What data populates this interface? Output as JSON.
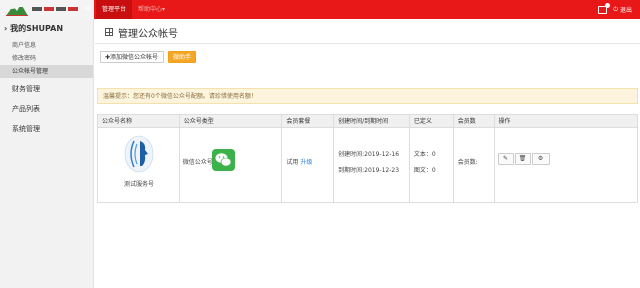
{
  "topbar": {
    "menu_icon": "hamburger-icon",
    "nav": [
      {
        "label": "管理平台",
        "active": true
      },
      {
        "label": "帮助中心▾",
        "active": false
      }
    ],
    "logout_label": "退出",
    "accent_color": "#e81818"
  },
  "sidebar": {
    "section_title": "我的SHUPAN",
    "sub_items": [
      "商户信息",
      "修改密码",
      "公众帐号管理"
    ],
    "active_sub": "公众帐号管理",
    "groups": [
      "财务管理",
      "产品列表",
      "系统管理"
    ]
  },
  "main": {
    "title": "管理公众帐号",
    "add_button": "✚添加微信公众帐号",
    "help_button": "微助手",
    "alert": "温馨提示：您还有0个微信公众号配额。请珍惜使用名额！",
    "table": {
      "headers": [
        "公众号名称",
        "公众号类型",
        "会员套餐",
        "创建时间/到期时间",
        "已定义",
        "会员数",
        "操作"
      ],
      "rows": [
        {
          "name": "测试服务号",
          "type": "微信公众号",
          "plan": "试用",
          "upgrade": "升级",
          "created": "创建时间:2019-12-16",
          "expires": "到期时间:2019-12-23",
          "defined_text": "文本：0",
          "defined_image": "图文：0",
          "members": "会员数:",
          "actions": [
            "edit-icon",
            "trash-icon",
            "gear-icon"
          ]
        }
      ]
    }
  }
}
